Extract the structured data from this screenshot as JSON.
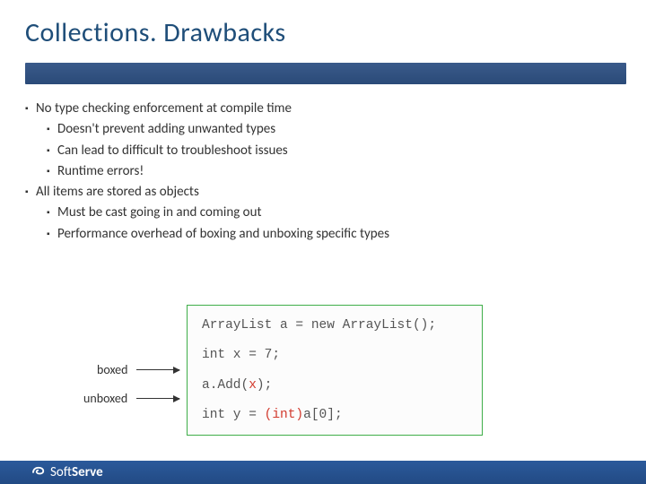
{
  "title": "Collections. Drawbacks",
  "bullets": {
    "b1": "No type checking enforcement at compile time",
    "b1a": "Doesn't prevent adding unwanted types",
    "b1b": "Can lead to difficult to troubleshoot issues",
    "b1c": "Runtime errors!",
    "b2": "All items are stored as objects",
    "b2a": "Must be cast going in and coming out",
    "b2b": "Performance overhead of boxing and unboxing specific types"
  },
  "labels": {
    "boxed": "boxed",
    "unboxed": "unboxed"
  },
  "code": {
    "l1": "ArrayList a = new ArrayList();",
    "l2": "int x = 7;",
    "l3a": "a.Add(",
    "l3b": "x",
    "l3c": ");",
    "l4a": "int y = ",
    "l4b": "(int)",
    "l4c": "a[0];"
  },
  "footer": {
    "brand_a": "Soft",
    "brand_b": "Serve"
  }
}
